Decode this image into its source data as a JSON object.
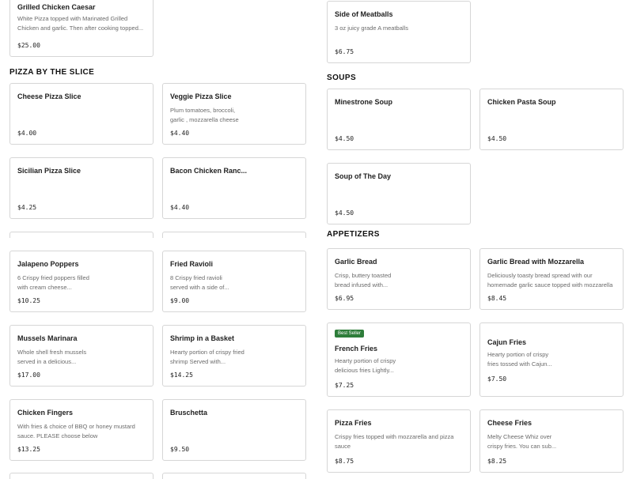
{
  "sections": {
    "pizza_slice": "PIZZA BY THE SLICE",
    "soups": "SOUPS",
    "appetizers": "APPETIZERS"
  },
  "left": {
    "grilled_chicken_caesar": {
      "title": "Grilled Chicken Caesar",
      "desc": "White Pizza topped with Marinated Grilled Chicken and garlic. Then after cooking topped...",
      "price": "$25.00"
    },
    "cheese_slice": {
      "title": "Cheese Pizza Slice",
      "desc": "",
      "price": "$4.00"
    },
    "veggie_slice": {
      "title": "Veggie Pizza Slice",
      "desc": "Plum tomatoes, broccoli, garlic , mozzarella cheese",
      "price": "$4.40"
    },
    "sicilian_slice": {
      "title": "Sicilian Pizza Slice",
      "desc": "",
      "price": "$4.25"
    },
    "bacon_ranch": {
      "title": "Bacon Chicken Ranc...",
      "desc": "",
      "price": "$4.40"
    },
    "jalapeno": {
      "title": "Jalapeno Poppers",
      "desc": "6 Crispy fried poppers filled with cream cheese...",
      "price": "$10.25"
    },
    "ravioli": {
      "title": "Fried Ravioli",
      "desc": "8 Crispy fried ravioli served with a side of...",
      "price": "$9.00"
    },
    "mussels": {
      "title": "Mussels Marinara",
      "desc": "Whole shell fresh mussels served in a delicious...",
      "price": "$17.00"
    },
    "shrimp": {
      "title": "Shrimp in a Basket",
      "desc": "Hearty portion of crispy fried shrimp Served with...",
      "price": "$14.25"
    },
    "fingers": {
      "title": "Chicken Fingers",
      "desc": "With fries & choice of BBQ or honey mustard sauce. PLEASE choose below",
      "price": "$13.25"
    },
    "bruschetta": {
      "title": "Bruschetta",
      "desc": "",
      "price": "$9.50"
    }
  },
  "right": {
    "meatballs": {
      "title": "Side of Meatballs",
      "desc": "3 oz juicy grade A meatballs",
      "price": "$6.75"
    },
    "minestrone": {
      "title": "Minestrone Soup",
      "desc": "",
      "price": "$4.50"
    },
    "chicken_pasta": {
      "title": "Chicken Pasta Soup",
      "desc": "",
      "price": "$4.50"
    },
    "soup_day": {
      "title": "Soup of The Day",
      "desc": "",
      "price": "$4.50"
    },
    "garlic_bread": {
      "title": "Garlic Bread",
      "desc": "Crisp, buttery toasted bread infused with...",
      "price": "$6.95"
    },
    "garlic_mozz": {
      "title": "Garlic Bread with Mozzarella",
      "desc": "Deliciously toasty bread spread with our homemade garlic sauce topped with mozzarella",
      "price": "$8.45"
    },
    "french_fries": {
      "title": "French Fries",
      "badge": "Best Seller",
      "desc": "Hearty portion of crispy delicious fries Lightly...",
      "price": "$7.25"
    },
    "cajun_fries": {
      "title": "Cajun Fries",
      "desc": "Hearty portion of crispy fries tossed with Cajun...",
      "price": "$7.50"
    },
    "pizza_fries": {
      "title": "Pizza Fries",
      "desc": "Crispy fries topped with mozzarella and pizza sauce",
      "price": "$8.75"
    },
    "cheese_fries": {
      "title": "Cheese Fries",
      "desc": "Melty Cheese Whiz over crispy fries. You can sub...",
      "price": "$8.25"
    }
  }
}
